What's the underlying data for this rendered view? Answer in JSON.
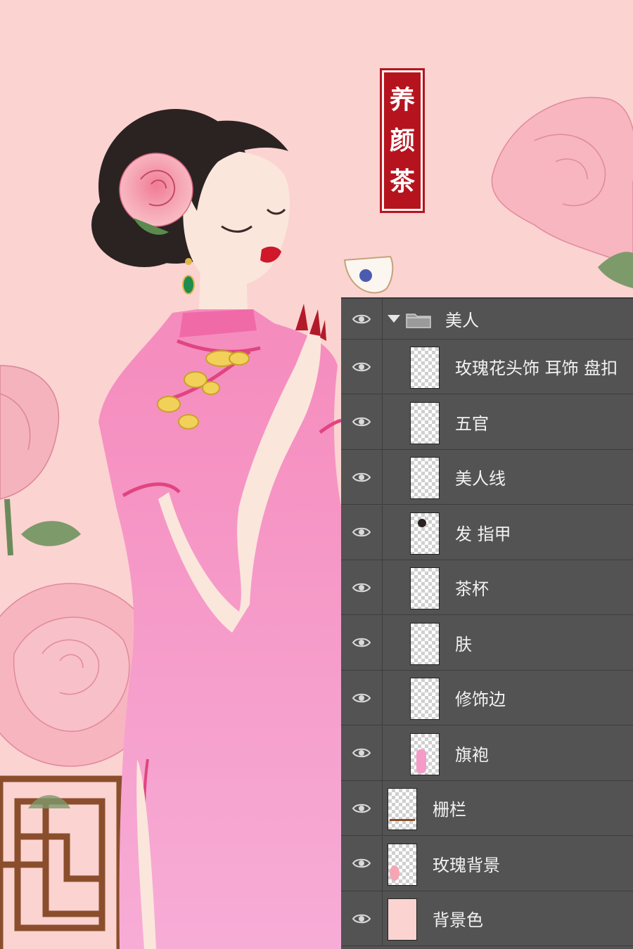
{
  "artwork": {
    "seal_text": [
      "养",
      "颜",
      "茶"
    ],
    "colors": {
      "background": "#fbd3d1",
      "qipao": "#f49bc8",
      "seal": "#b5141f",
      "rose": "#f4a6b4",
      "panel": "#535353"
    }
  },
  "layers_panel": {
    "group": {
      "name": "美人",
      "expanded": true,
      "icon": "folder-icon"
    },
    "layers": [
      {
        "name": "玫瑰花头饰 耳饰 盘扣",
        "visible": true,
        "in_group": true
      },
      {
        "name": "五官",
        "visible": true,
        "in_group": true
      },
      {
        "name": "美人线",
        "visible": true,
        "in_group": true
      },
      {
        "name": "发  指甲",
        "visible": true,
        "in_group": true
      },
      {
        "name": "茶杯",
        "visible": true,
        "in_group": true
      },
      {
        "name": "肤",
        "visible": true,
        "in_group": true
      },
      {
        "name": "修饰边",
        "visible": true,
        "in_group": true
      },
      {
        "name": "旗袍",
        "visible": true,
        "in_group": true
      },
      {
        "name": "栅栏",
        "visible": true,
        "in_group": false
      },
      {
        "name": "玫瑰背景",
        "visible": true,
        "in_group": false
      },
      {
        "name": "背景色",
        "visible": true,
        "in_group": false
      }
    ]
  }
}
